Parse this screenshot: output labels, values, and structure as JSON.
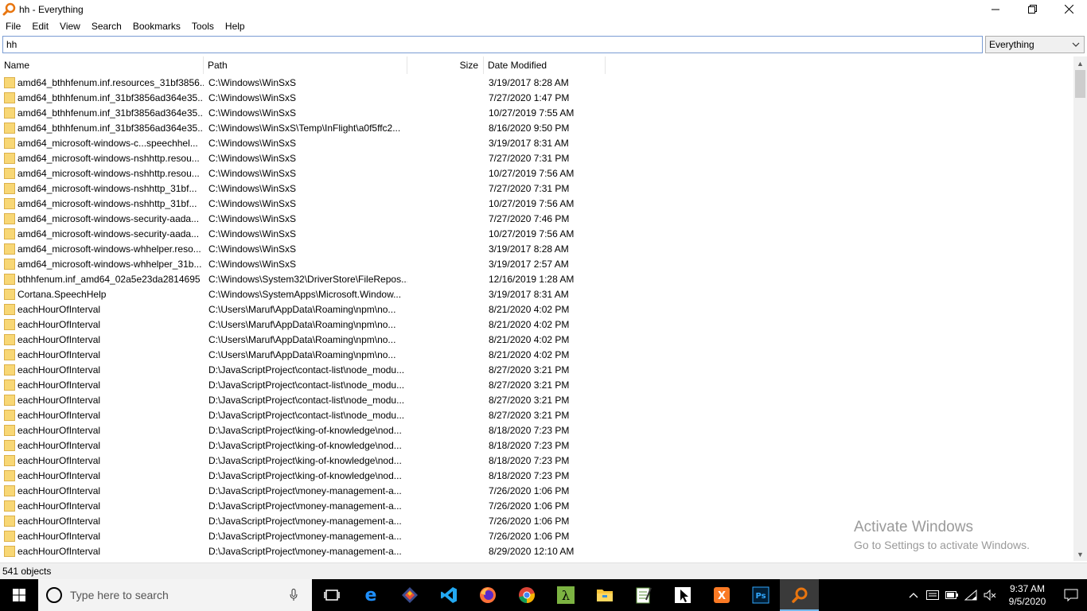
{
  "window": {
    "title": "hh - Everything",
    "minimize_icon": "minimize-icon",
    "restore_icon": "restore-icon",
    "close_icon": "close-icon"
  },
  "menu": [
    "File",
    "Edit",
    "View",
    "Search",
    "Bookmarks",
    "Tools",
    "Help"
  ],
  "search": {
    "value": "hh",
    "filter": "Everything"
  },
  "columns": {
    "name": "Name",
    "path": "Path",
    "size": "Size",
    "date": "Date Modified"
  },
  "rows": [
    {
      "name": "amd64_bthhfenum.inf.resources_31bf3856...",
      "path": "C:\\Windows\\WinSxS",
      "size": "",
      "date": "3/19/2017 8:28 AM"
    },
    {
      "name": "amd64_bthhfenum.inf_31bf3856ad364e35...",
      "path": "C:\\Windows\\WinSxS",
      "size": "",
      "date": "7/27/2020 1:47 PM"
    },
    {
      "name": "amd64_bthhfenum.inf_31bf3856ad364e35...",
      "path": "C:\\Windows\\WinSxS",
      "size": "",
      "date": "10/27/2019 7:55 AM"
    },
    {
      "name": "amd64_bthhfenum.inf_31bf3856ad364e35...",
      "path": "C:\\Windows\\WinSxS\\Temp\\InFlight\\a0f5ffc2...",
      "size": "",
      "date": "8/16/2020 9:50 PM"
    },
    {
      "name": "amd64_microsoft-windows-c...speechhel...",
      "path": "C:\\Windows\\WinSxS",
      "size": "",
      "date": "3/19/2017 8:31 AM"
    },
    {
      "name": "amd64_microsoft-windows-nshhttp.resou...",
      "path": "C:\\Windows\\WinSxS",
      "size": "",
      "date": "7/27/2020 7:31 PM"
    },
    {
      "name": "amd64_microsoft-windows-nshhttp.resou...",
      "path": "C:\\Windows\\WinSxS",
      "size": "",
      "date": "10/27/2019 7:56 AM"
    },
    {
      "name": "amd64_microsoft-windows-nshhttp_31bf...",
      "path": "C:\\Windows\\WinSxS",
      "size": "",
      "date": "7/27/2020 7:31 PM"
    },
    {
      "name": "amd64_microsoft-windows-nshhttp_31bf...",
      "path": "C:\\Windows\\WinSxS",
      "size": "",
      "date": "10/27/2019 7:56 AM"
    },
    {
      "name": "amd64_microsoft-windows-security-aada...",
      "path": "C:\\Windows\\WinSxS",
      "size": "",
      "date": "7/27/2020 7:46 PM"
    },
    {
      "name": "amd64_microsoft-windows-security-aada...",
      "path": "C:\\Windows\\WinSxS",
      "size": "",
      "date": "10/27/2019 7:56 AM"
    },
    {
      "name": "amd64_microsoft-windows-whhelper.reso...",
      "path": "C:\\Windows\\WinSxS",
      "size": "",
      "date": "3/19/2017 8:28 AM"
    },
    {
      "name": "amd64_microsoft-windows-whhelper_31b...",
      "path": "C:\\Windows\\WinSxS",
      "size": "",
      "date": "3/19/2017 2:57 AM"
    },
    {
      "name": "bthhfenum.inf_amd64_02a5e23da2814695",
      "path": "C:\\Windows\\System32\\DriverStore\\FileRepos...",
      "size": "",
      "date": "12/16/2019 1:28 AM"
    },
    {
      "name": "Cortana.SpeechHelp",
      "path": "C:\\Windows\\SystemApps\\Microsoft.Window...",
      "size": "",
      "date": "3/19/2017 8:31 AM"
    },
    {
      "name": "eachHourOfInterval",
      "path": "C:\\Users\\Maruf\\AppData\\Roaming\\npm\\no...",
      "size": "",
      "date": "8/21/2020 4:02 PM"
    },
    {
      "name": "eachHourOfInterval",
      "path": "C:\\Users\\Maruf\\AppData\\Roaming\\npm\\no...",
      "size": "",
      "date": "8/21/2020 4:02 PM"
    },
    {
      "name": "eachHourOfInterval",
      "path": "C:\\Users\\Maruf\\AppData\\Roaming\\npm\\no...",
      "size": "",
      "date": "8/21/2020 4:02 PM"
    },
    {
      "name": "eachHourOfInterval",
      "path": "C:\\Users\\Maruf\\AppData\\Roaming\\npm\\no...",
      "size": "",
      "date": "8/21/2020 4:02 PM"
    },
    {
      "name": "eachHourOfInterval",
      "path": "D:\\JavaScriptProject\\contact-list\\node_modu...",
      "size": "",
      "date": "8/27/2020 3:21 PM"
    },
    {
      "name": "eachHourOfInterval",
      "path": "D:\\JavaScriptProject\\contact-list\\node_modu...",
      "size": "",
      "date": "8/27/2020 3:21 PM"
    },
    {
      "name": "eachHourOfInterval",
      "path": "D:\\JavaScriptProject\\contact-list\\node_modu...",
      "size": "",
      "date": "8/27/2020 3:21 PM"
    },
    {
      "name": "eachHourOfInterval",
      "path": "D:\\JavaScriptProject\\contact-list\\node_modu...",
      "size": "",
      "date": "8/27/2020 3:21 PM"
    },
    {
      "name": "eachHourOfInterval",
      "path": "D:\\JavaScriptProject\\king-of-knowledge\\nod...",
      "size": "",
      "date": "8/18/2020 7:23 PM"
    },
    {
      "name": "eachHourOfInterval",
      "path": "D:\\JavaScriptProject\\king-of-knowledge\\nod...",
      "size": "",
      "date": "8/18/2020 7:23 PM"
    },
    {
      "name": "eachHourOfInterval",
      "path": "D:\\JavaScriptProject\\king-of-knowledge\\nod...",
      "size": "",
      "date": "8/18/2020 7:23 PM"
    },
    {
      "name": "eachHourOfInterval",
      "path": "D:\\JavaScriptProject\\king-of-knowledge\\nod...",
      "size": "",
      "date": "8/18/2020 7:23 PM"
    },
    {
      "name": "eachHourOfInterval",
      "path": "D:\\JavaScriptProject\\money-management-a...",
      "size": "",
      "date": "7/26/2020 1:06 PM"
    },
    {
      "name": "eachHourOfInterval",
      "path": "D:\\JavaScriptProject\\money-management-a...",
      "size": "",
      "date": "7/26/2020 1:06 PM"
    },
    {
      "name": "eachHourOfInterval",
      "path": "D:\\JavaScriptProject\\money-management-a...",
      "size": "",
      "date": "7/26/2020 1:06 PM"
    },
    {
      "name": "eachHourOfInterval",
      "path": "D:\\JavaScriptProject\\money-management-a...",
      "size": "",
      "date": "7/26/2020 1:06 PM"
    },
    {
      "name": "eachHourOfInterval",
      "path": "D:\\JavaScriptProject\\money-management-a...",
      "size": "",
      "date": "8/29/2020 12:10 AM"
    }
  ],
  "status": {
    "count": "541 objects"
  },
  "watermark": {
    "line1": "Activate Windows",
    "line2": "Go to Settings to activate Windows."
  },
  "taskbar": {
    "search_placeholder": "Type here to search",
    "apps": [
      "task-view-icon",
      "edge-icon",
      "git-icon",
      "vscode-icon",
      "firefox-icon",
      "chrome-icon",
      "lambda-icon",
      "file-explorer-icon",
      "notepad-icon",
      "snipping-tool-icon",
      "xampp-icon",
      "photoshop-icon",
      "everything-icon"
    ],
    "time": "9:37 AM",
    "date": "9/5/2020"
  },
  "colors": {
    "folder": "#f8d775",
    "taskbar_bg": "#000000",
    "accent": "#76b9ed"
  }
}
